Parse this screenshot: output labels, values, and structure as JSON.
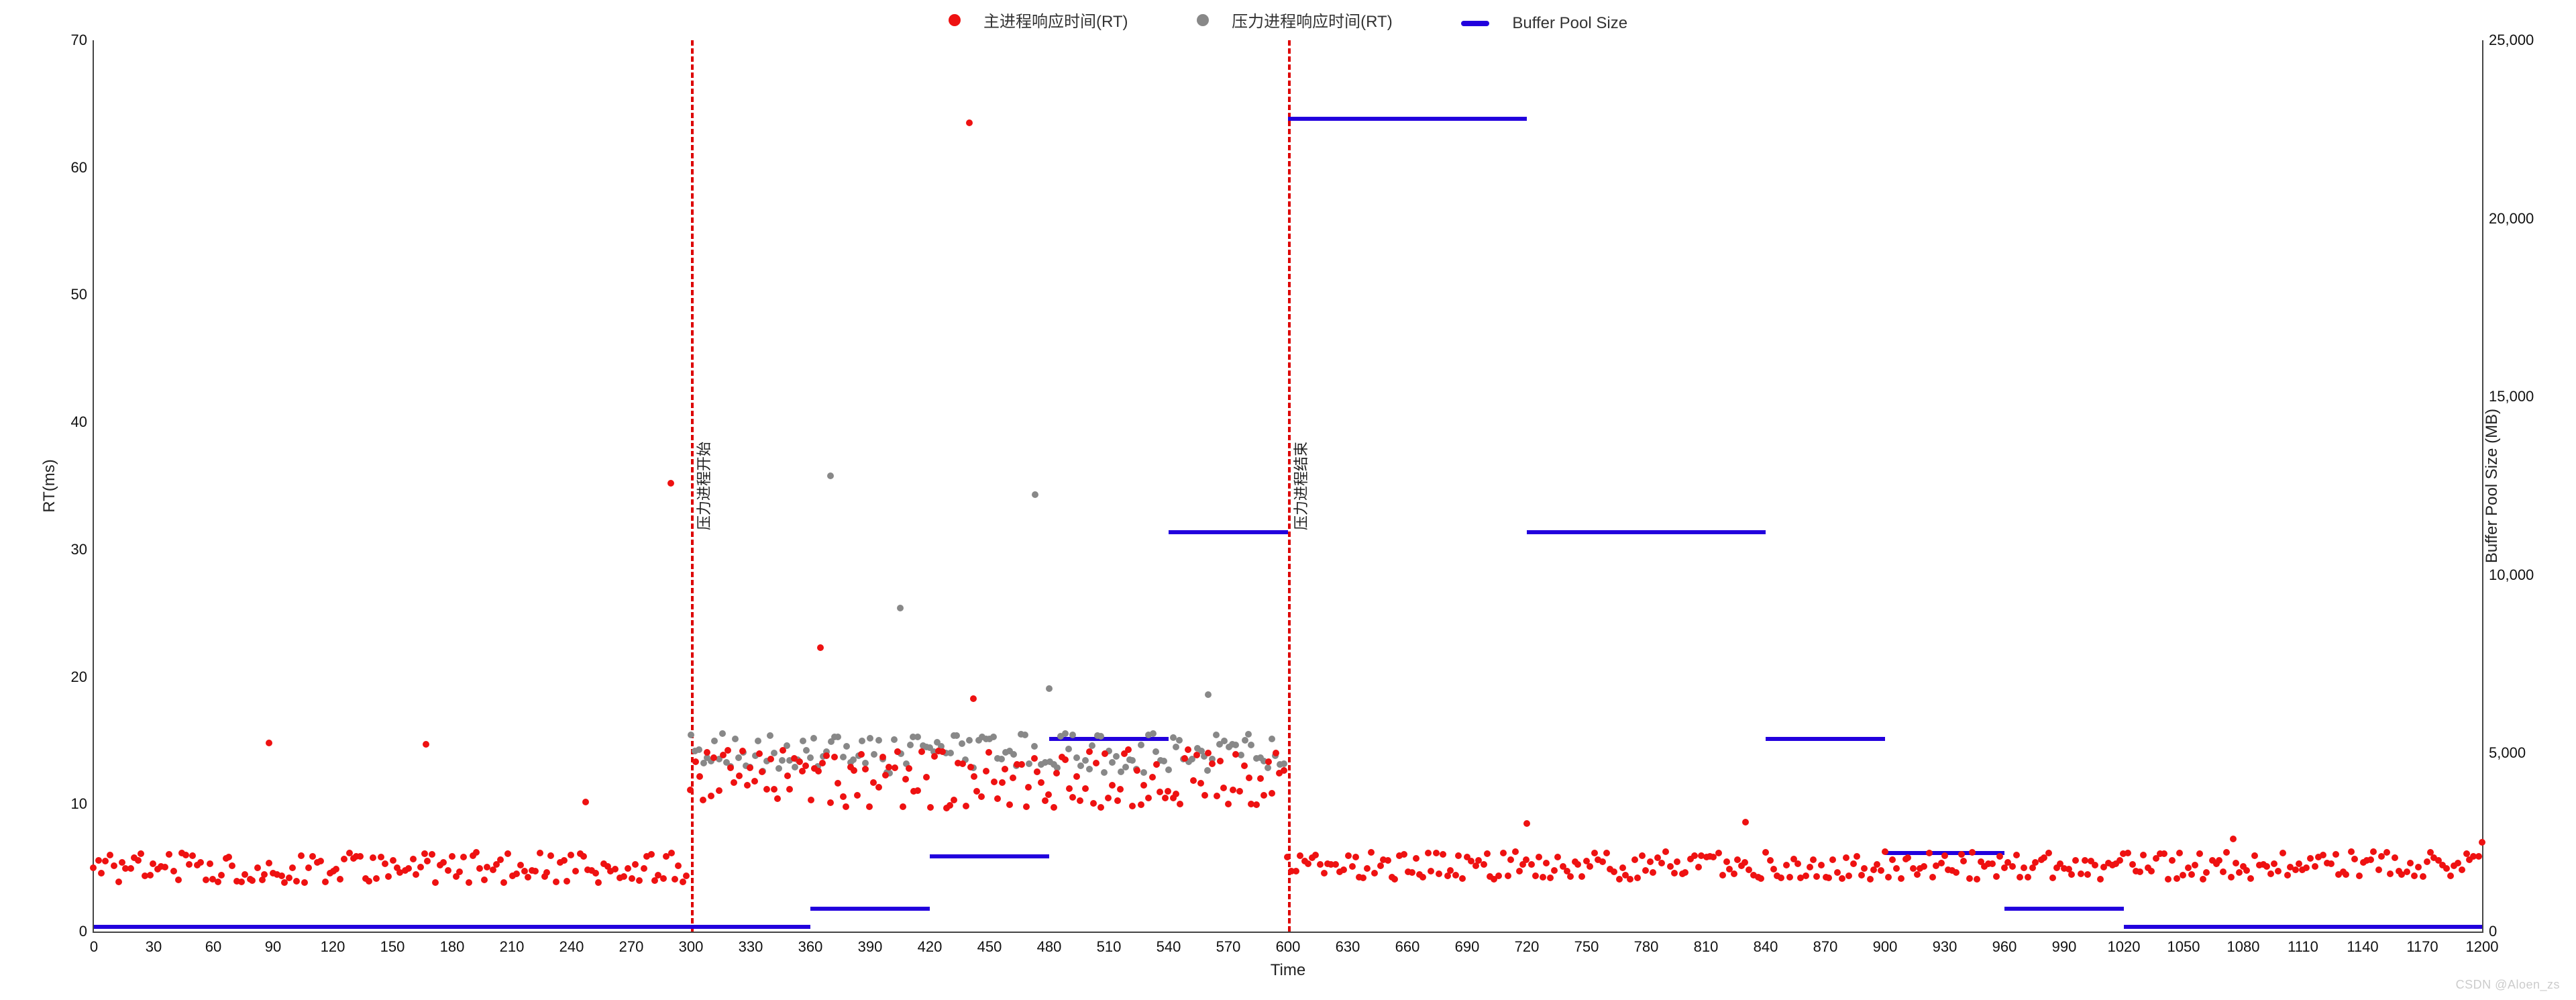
{
  "chart_data": {
    "type": "scatter",
    "x_range": [
      0,
      1200
    ],
    "y_left_range": [
      0,
      70
    ],
    "y_right_range": [
      0,
      25000
    ],
    "xlabel": "Time",
    "ylabel_left": "RT(ms)",
    "ylabel_right": "Buffer Pool Size (MB)",
    "x_tick_step": 30,
    "y_left_ticks": [
      0,
      10,
      20,
      30,
      40,
      50,
      60,
      70
    ],
    "y_right_ticks": [
      0,
      5000,
      10000,
      15000,
      20000,
      25000
    ],
    "legend": [
      {
        "label": "主进程响应时间(RT)",
        "marker": "dot",
        "color": "#e11"
      },
      {
        "label": "压力进程响应时间(RT)",
        "marker": "dot",
        "color": "#888"
      },
      {
        "label": "Buffer Pool Size",
        "marker": "bar",
        "color": "#20d"
      }
    ],
    "vlines": [
      {
        "x": 300,
        "label": "压力进程开始"
      },
      {
        "x": 600,
        "label": "压力进程结束"
      }
    ],
    "series_main_process": {
      "name": "主进程响应时间(RT)",
      "color": "#e11",
      "segments": [
        {
          "x_from": 0,
          "x_to": 300,
          "baseline": 5.0,
          "jitter": 1.2
        },
        {
          "x_from": 300,
          "x_to": 600,
          "baseline": 12.0,
          "jitter": 2.3
        },
        {
          "x_from": 600,
          "x_to": 1200,
          "baseline": 5.2,
          "jitter": 1.1
        }
      ],
      "outliers": [
        {
          "x": 88,
          "y": 14.8
        },
        {
          "x": 167,
          "y": 14.7
        },
        {
          "x": 247,
          "y": 10.2
        },
        {
          "x": 290,
          "y": 35.2
        },
        {
          "x": 365,
          "y": 22.3
        },
        {
          "x": 440,
          "y": 63.5
        },
        {
          "x": 442,
          "y": 18.3
        },
        {
          "x": 720,
          "y": 8.5
        },
        {
          "x": 830,
          "y": 8.6
        },
        {
          "x": 1075,
          "y": 7.3
        },
        {
          "x": 1200,
          "y": 7.0
        }
      ]
    },
    "series_stress_process": {
      "name": "压力进程响应时间(RT)",
      "color": "#888",
      "segments": [
        {
          "x_from": 300,
          "x_to": 600,
          "baseline": 14.0,
          "jitter": 1.6
        }
      ],
      "outliers": [
        {
          "x": 370,
          "y": 35.8
        },
        {
          "x": 405,
          "y": 25.4
        },
        {
          "x": 473,
          "y": 34.3
        },
        {
          "x": 480,
          "y": 19.1
        },
        {
          "x": 560,
          "y": 18.6
        }
      ]
    },
    "buffer_pool_steps": {
      "name": "Buffer Pool Size",
      "color": "#20d",
      "unit": "MB",
      "segments": [
        {
          "x_from": 0,
          "x_to": 300,
          "value": 128
        },
        {
          "x_from": 300,
          "x_to": 360,
          "value": 128
        },
        {
          "x_from": 360,
          "x_to": 420,
          "value": 640
        },
        {
          "x_from": 420,
          "x_to": 480,
          "value": 2100
        },
        {
          "x_from": 480,
          "x_to": 540,
          "value": 5400
        },
        {
          "x_from": 540,
          "x_to": 600,
          "value": 11200
        },
        {
          "x_from": 600,
          "x_to": 720,
          "value": 22800
        },
        {
          "x_from": 720,
          "x_to": 840,
          "value": 11200
        },
        {
          "x_from": 840,
          "x_to": 900,
          "value": 5400
        },
        {
          "x_from": 900,
          "x_to": 960,
          "value": 2200
        },
        {
          "x_from": 960,
          "x_to": 1020,
          "value": 640
        },
        {
          "x_from": 1020,
          "x_to": 1200,
          "value": 128
        }
      ]
    }
  },
  "y_right_tick_labels": {
    "0": "0",
    "5000": "5,000",
    "10000": "10,000",
    "15000": "15,000",
    "20000": "20,000",
    "25000": "25,000"
  },
  "watermark": "CSDN @Aloen_zs"
}
